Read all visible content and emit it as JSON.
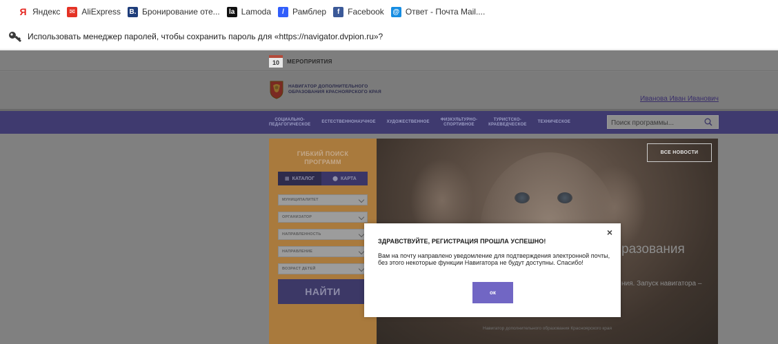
{
  "bookmarks": [
    {
      "label": "Яндекс",
      "icon": "yandex-icon",
      "glyph": "Я",
      "color": "#e52620"
    },
    {
      "label": "AliExpress",
      "icon": "aliexpress-icon",
      "glyph": "✉",
      "color": "#e43225"
    },
    {
      "label": "Бронирование оте...",
      "icon": "booking-icon",
      "glyph": "B.",
      "color": "#1e3d7a"
    },
    {
      "label": "Lamoda",
      "icon": "lamoda-icon",
      "glyph": "la",
      "color": "#111111"
    },
    {
      "label": "Рамблер",
      "icon": "rambler-icon",
      "glyph": "/",
      "color": "#315efb"
    },
    {
      "label": "Facebook",
      "icon": "facebook-icon",
      "glyph": "f",
      "color": "#3b5998"
    },
    {
      "label": "Ответ - Почта Mail....",
      "icon": "mail-icon",
      "glyph": "@",
      "color": "#168de2"
    }
  ],
  "password_bar": {
    "text": "Использовать менеджер паролей, чтобы сохранить пароль для «https://navigator.dvpion.ru»?"
  },
  "site": {
    "events": {
      "day": "10",
      "label": "МЕРОПРИЯТИЯ"
    },
    "logo_line1": "НАВИГАТОР ДОПОЛНИТЕЛЬНОГО",
    "logo_line2": "ОБРАЗОВАНИЯ КРАСНОЯРСКОГО КРАЯ",
    "user_name": "Иванова Иван Иванович",
    "nav": [
      {
        "line1": "СОЦИАЛЬНО-",
        "line2": "ПЕДАГОГИЧЕСКОЕ"
      },
      {
        "line1": "ЕСТЕСТВЕННОНАУЧНОЕ",
        "line2": ""
      },
      {
        "line1": "ХУДОЖЕСТВЕННОЕ",
        "line2": ""
      },
      {
        "line1": "ФИЗКУЛЬТУРНО-",
        "line2": "СПОРТИВНОЕ"
      },
      {
        "line1": "ТУРИСТСКО-",
        "line2": "КРАЕВЕДЧЕСКОЕ"
      },
      {
        "line1": "ТЕХНИЧЕСКОЕ",
        "line2": ""
      }
    ],
    "search_placeholder": "Поиск программы...",
    "sidebar": {
      "title_line1": "ГИБКИЙ ПОИСК",
      "title_line2": "ПРОГРАММ",
      "tab_catalog": "КАТАЛОГ",
      "tab_map": "КАРТА",
      "filters": [
        "МУНИЦИПАЛИТЕТ",
        "ОРГАНИЗАТОР",
        "НАПРАВЛЕННОСТЬ",
        "НАПРАВЛЕНИЕ",
        "ВОЗРАСТ ДЕТЕЙ"
      ],
      "find_button": "НАЙТИ"
    },
    "banner": {
      "all_news": "ВСЕ НОВОСТИ",
      "title_fragment": "разования",
      "subtitle_fragment": "ния. Запуск навигатора –",
      "caption": "Навигатор дополнительного образования Красноярского края"
    }
  },
  "modal": {
    "close": "×",
    "title": "ЗДРАВСТВУЙТЕ, РЕГИСТРАЦИЯ ПРОШЛА УСПЕШНО!",
    "text": "Вам на почту направлено уведомление для подтверждения электронной почты,  без этого некоторые функции Навигатора не будут доступны. Спасибо!",
    "ok": "ок"
  }
}
